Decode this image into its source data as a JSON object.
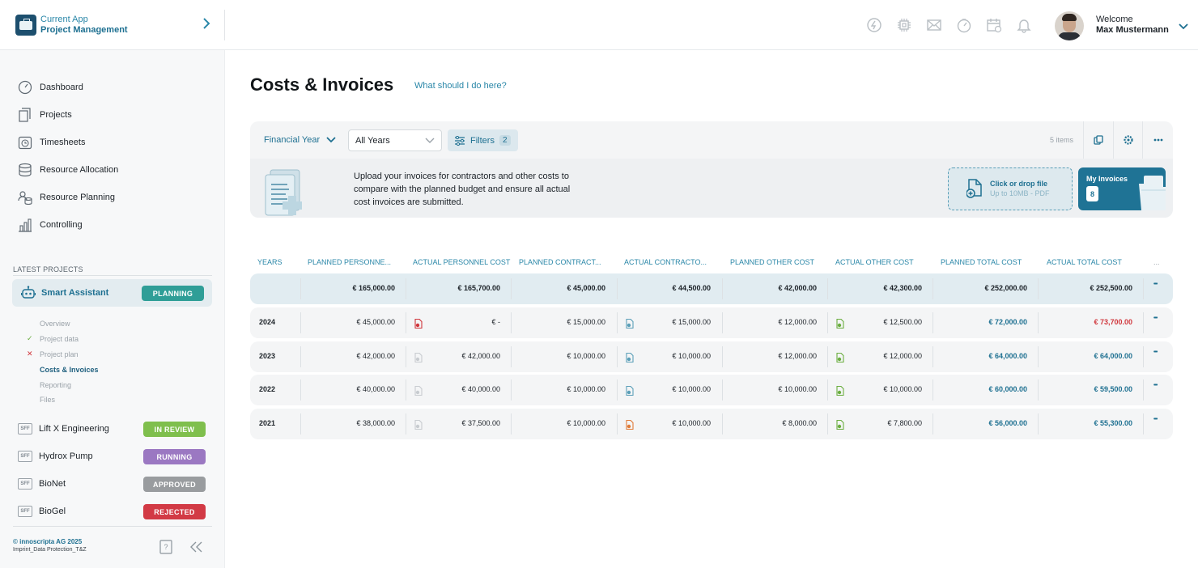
{
  "header": {
    "app_sub": "Current App",
    "app_name": "Project Management",
    "welcome": "Welcome",
    "user_name": "Max Mustermann",
    "icons": [
      "chat-icon",
      "chip-icon",
      "mail-icon",
      "dashboard-gauge-icon",
      "calendar-icon",
      "bell-icon"
    ]
  },
  "sidebar": {
    "nav": [
      {
        "label": "Dashboard",
        "icon": "gauge-icon"
      },
      {
        "label": "Projects",
        "icon": "documents-icon"
      },
      {
        "label": "Timesheets",
        "icon": "clock-icon"
      },
      {
        "label": "Resource Allocation",
        "icon": "database-icon"
      },
      {
        "label": "Resource Planning",
        "icon": "people-database-icon"
      },
      {
        "label": "Controlling",
        "icon": "bar-chart-icon"
      }
    ],
    "latest_title": "LATEST PROJECTS",
    "active_project": {
      "name": "Smart Assistant",
      "status": "PLANNING",
      "status_color": "#2f9e97"
    },
    "sub_items": [
      {
        "label": "Overview",
        "mark": ""
      },
      {
        "label": "Project data",
        "mark": "✓"
      },
      {
        "label": "Project plan",
        "mark": "✕"
      },
      {
        "label": "Costs & Invoices",
        "mark": ""
      },
      {
        "label": "Reporting",
        "mark": ""
      },
      {
        "label": "Files",
        "mark": ""
      }
    ],
    "projects": [
      {
        "name": "Lift X Engineering",
        "status": "IN REVIEW",
        "color": "#7fbf4d",
        "logo": "SFF"
      },
      {
        "name": "Hydrox Pump",
        "status": "RUNNING",
        "color": "#9b78c2",
        "logo": "SFF"
      },
      {
        "name": "BioNet",
        "status": "APPROVED",
        "color": "#999c9f",
        "logo": "SFF"
      },
      {
        "name": "BioGel",
        "status": "REJECTED",
        "color": "#d23a45",
        "logo": "SFF"
      }
    ],
    "footer_copy": "© innoscripta AG 2025",
    "footer_links": "Imprint_Data Protection_T&Z"
  },
  "main": {
    "title": "Costs & Invoices",
    "help_link": "What should I do here?",
    "financial_year": "Financial Year",
    "years_select": "All Years",
    "filters_label": "Filters",
    "filters_count": "2",
    "items_count": "5 items",
    "upload_text": "Upload your invoices for contractors and other costs to compare with the planned budget and ensure all actual cost invoices are submitted.",
    "drop_title": "Click or drop file",
    "drop_sub": "Up to 10MB - PDF",
    "my_invoices_label": "My Invoices",
    "my_invoices_count": "8"
  },
  "table": {
    "headers": [
      "YEARS",
      "PLANNED PERSONNE...",
      "ACTUAL PERSONNEL COST",
      "PLANNED CONTRACT...",
      "ACTUAL CONTRACTO...",
      "PLANNED OTHER COST",
      "ACTUAL  OTHER COST",
      "PLANNED TOTAL COST",
      "ACTUAL TOTAL COST",
      "..."
    ],
    "total": {
      "pp": "€ 165,000.00",
      "ap": "€ 165,700.00",
      "pc": "€ 45,000.00",
      "ac": "€ 44,500.00",
      "po": "€ 42,000.00",
      "ao": "€ 42,300.00",
      "pt": "€ 252,000.00",
      "at": "€ 252,500.00"
    },
    "rows": [
      {
        "year": "2024",
        "pp": "€ 45,000.00",
        "ap": "€ -",
        "pc": "€ 15,000.00",
        "ac": "€ 15,000.00",
        "po": "€ 12,000.00",
        "ao": "€ 12,500.00",
        "pt": "€ 72,000.00",
        "at": "€ 73,700.00",
        "at_over": true,
        "ap_doc": "#d0363c",
        "ac_doc": "#5b9fb8",
        "ao_doc": "#6aad3f"
      },
      {
        "year": "2023",
        "pp": "€ 42,000.00",
        "ap": "€ 42,000.00",
        "pc": "€ 10,000.00",
        "ac": "€ 10,000.00",
        "po": "€ 12,000.00",
        "ao": "€ 12,000.00",
        "pt": "€ 64,000.00",
        "at": "€ 64,000.00",
        "at_over": false,
        "ap_doc": "#c8ccd0",
        "ac_doc": "#5b9fb8",
        "ao_doc": "#6aad3f"
      },
      {
        "year": "2022",
        "pp": "€ 40,000.00",
        "ap": "€ 40,000.00",
        "pc": "€ 10,000.00",
        "ac": "€ 10,000.00",
        "po": "€ 10,000.00",
        "ao": "€ 10,000.00",
        "pt": "€ 60,000.00",
        "at": "€ 59,500.00",
        "at_over": false,
        "ap_doc": "#c8ccd0",
        "ac_doc": "#5b9fb8",
        "ao_doc": "#6aad3f"
      },
      {
        "year": "2021",
        "pp": "€ 38,000.00",
        "ap": "€ 37,500.00",
        "pc": "€ 10,000.00",
        "ac": "€ 10,000.00",
        "po": "€ 8,000.00",
        "ao": "€ 7,800.00",
        "pt": "€ 56,000.00",
        "at": "€ 55,300.00",
        "at_over": false,
        "ap_doc": "#c8ccd0",
        "ac_doc": "#e07b39",
        "ao_doc": "#6aad3f"
      }
    ]
  }
}
